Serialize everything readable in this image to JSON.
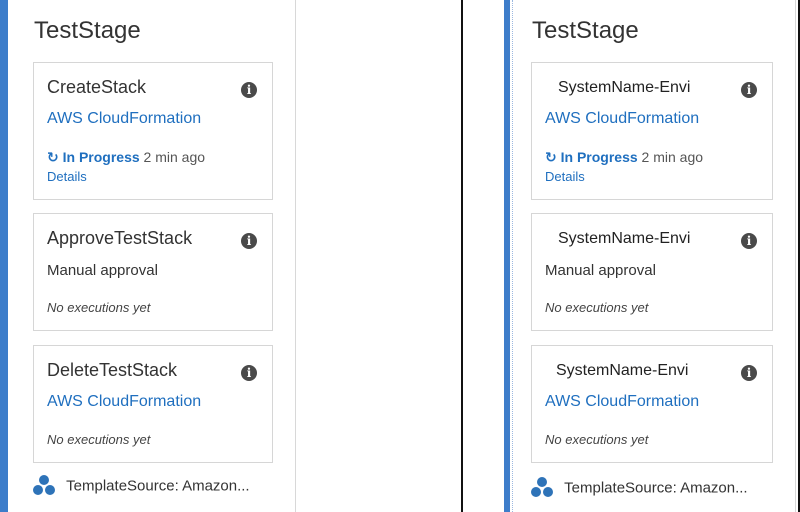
{
  "panels": [
    {
      "stage_title": "TestStage",
      "actions": [
        {
          "title": "CreateStack",
          "provider": "AWS CloudFormation",
          "status": "In Progress",
          "status_time": "2 min ago",
          "details": "Details",
          "no_exec": ""
        },
        {
          "title": "ApproveTestStack",
          "manual": "Manual approval",
          "no_exec": "No executions yet"
        },
        {
          "title": "DeleteTestStack",
          "provider": "AWS CloudFormation",
          "no_exec": "No executions yet"
        }
      ],
      "source": "TemplateSource: Amazon..."
    },
    {
      "stage_title": "TestStage",
      "actions": [
        {
          "title": "SystemName-Envi",
          "provider": "AWS CloudFormation",
          "status": "In Progress",
          "status_time": "2 min ago",
          "details": "Details",
          "no_exec": ""
        },
        {
          "title": "SystemName-Envi",
          "manual": "Manual approval",
          "no_exec": "No executions yet"
        },
        {
          "title": "SystemName-Envi",
          "provider": "AWS CloudFormation",
          "no_exec": "No executions yet"
        }
      ],
      "source": "TemplateSource: Amazon..."
    }
  ],
  "icons": {
    "info": "info-icon",
    "status": "sync-icon",
    "source": "artifact-icon"
  },
  "colors": {
    "accent_bar": "#3d7dca",
    "link": "#1f6fbf",
    "text": "#333333",
    "card_border": "#d6d6d6",
    "source_icon": "#2e73b8"
  }
}
